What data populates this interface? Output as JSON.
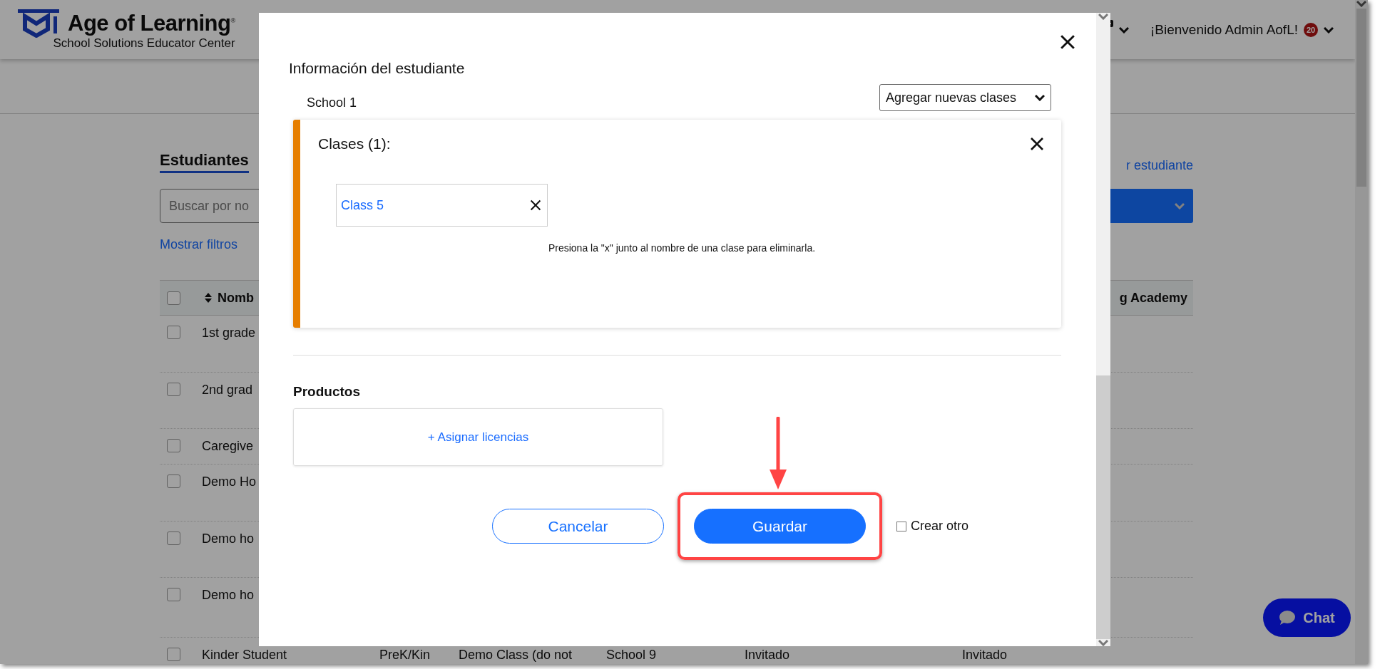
{
  "header": {
    "brand": "Age of Learning",
    "registered": "®",
    "subtitle": "School Solutions Educator Center",
    "welcome": "¡Bienvenido Admin AofL!",
    "notification_count": "20"
  },
  "page": {
    "title": "Estudiantes",
    "add_link": "r estudiante",
    "search": {
      "placeholder": "Buscar por no"
    },
    "filters_link": "Mostrar filtros",
    "table": {
      "header_checked": false,
      "columns": [
        {
          "label": "Nomb"
        },
        {
          "label": "g Academy"
        }
      ],
      "rows": [
        {
          "checked": false,
          "cells": [
            "1st grade"
          ]
        },
        {
          "checked": false,
          "cells": [
            "2nd grad"
          ]
        },
        {
          "checked": false,
          "cells": [
            "Caregive"
          ]
        },
        {
          "checked": false,
          "cells": [
            "Demo Ho"
          ]
        },
        {
          "checked": false,
          "cells": [
            "Demo ho"
          ]
        },
        {
          "checked": false,
          "cells": [
            "Demo ho"
          ]
        },
        {
          "checked": false,
          "cells": [
            "Kinder Student",
            "PreK/Kin",
            "Demo Class (do not",
            "School 9",
            "Invitado",
            "Invitado"
          ]
        }
      ]
    }
  },
  "modal": {
    "title": "Información del estudiante",
    "school": "School 1",
    "add_classes_select": "Agregar nuevas clases",
    "classes_title": "Clases (1):",
    "classes": [
      {
        "name": "Class 5"
      }
    ],
    "hint": "Presiona la \"x\" junto al nombre de una clase para eliminarla.",
    "products_title": "Productos",
    "assign_link": "+ Asignar licencias",
    "cancel": "Cancelar",
    "save": "Guardar",
    "create_another": {
      "label": "Crear otro",
      "checked": false
    }
  },
  "chat": "Chat"
}
